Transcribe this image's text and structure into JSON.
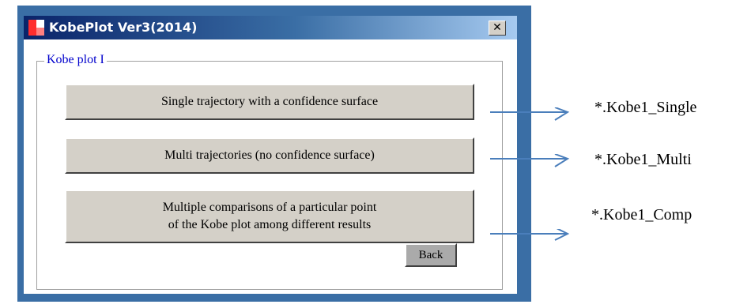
{
  "window": {
    "title": "KobePlot  Ver3(2014)",
    "close_symbol": "✕"
  },
  "group": {
    "label": "Kobe plot I"
  },
  "buttons": {
    "single": "Single trajectory with a confidence surface",
    "multi": "Multi trajectories (no confidence surface)",
    "comp_line1": "Multiple comparisons of a particular point",
    "comp_line2": "of the Kobe plot among different results",
    "back": "Back"
  },
  "outputs": {
    "single": "*.Kobe1_Single",
    "multi": "*.Kobe1_Multi",
    "comp": "*.Kobe1_Comp"
  },
  "colors": {
    "frame": "#3a6ea5",
    "titlebar_start": "#0a246a",
    "group_label": "#0000cc",
    "arrow": "#4a7ebb"
  }
}
